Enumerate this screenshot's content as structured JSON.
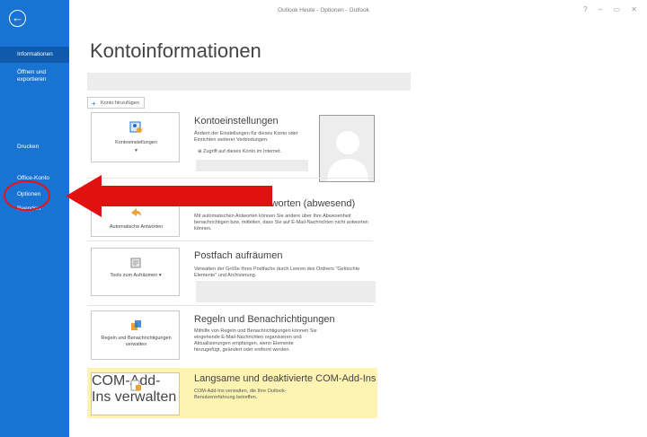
{
  "window": {
    "title": "Outlook Heute - Optionen - Outlook",
    "controls": "? – ▭ ✕"
  },
  "sidebar": {
    "back_icon": "back-arrow-icon",
    "items": [
      {
        "label": "Informationen",
        "active": true
      },
      {
        "label": "Öffnen und exportieren"
      },
      {
        "label": "Drucken"
      },
      {
        "label": "Office-Konto"
      },
      {
        "label": "Optionen"
      },
      {
        "label": "Beenden"
      }
    ]
  },
  "main": {
    "title": "Kontoinformationen",
    "add_account_label": "Konto hinzufügen",
    "sections": [
      {
        "tile_label": "Kontoeinstellungen",
        "tile_arrow": "▾",
        "title": "Kontoeinstellungen",
        "description": "Ändern der Einstellungen für dieses Konto oder Einrichten weiterer Verbindungen.",
        "link": "Zugriff auf dieses Konto im Internet."
      },
      {
        "tile_label": "Automatische Antworten",
        "title": "Automatische Antworten (abwesend)",
        "description": "Mit automatischen Antworten können Sie andere über Ihre Abwesenheit benachrichtigen bzw. mitteilen, dass Sie auf E-Mail-Nachrichten nicht antworten können."
      },
      {
        "tile_label": "Tools zum Aufräumen ▾",
        "title": "Postfach aufräumen",
        "description": "Verwalten der Größe Ihres Postfachs durch Leeren des Ordners \"Gelöschte Elemente\" und Archivierung."
      },
      {
        "tile_label": "Regeln und Benachrichtigungen verwalten",
        "title": "Regeln und Benachrichtigungen",
        "description": "Mithilfe von Regeln und Benachrichtigungen können Sie eingehende E-Mail-Nachrichten organisieren und Aktualisierungen empfangen, wenn Elemente hinzugefügt, geändert oder entfernt werden."
      },
      {
        "tile_label": "COM-Add-Ins verwalten",
        "title": "Langsame und deaktivierte COM-Add-Ins",
        "description": "COM-Add-Ins verwalten, die Ihre Outlook-Benutzererfahrung betreffen."
      }
    ]
  },
  "colors": {
    "sidebar": "#1873d3",
    "annotation": "#e11111",
    "highlight": "#fdf3b3"
  }
}
